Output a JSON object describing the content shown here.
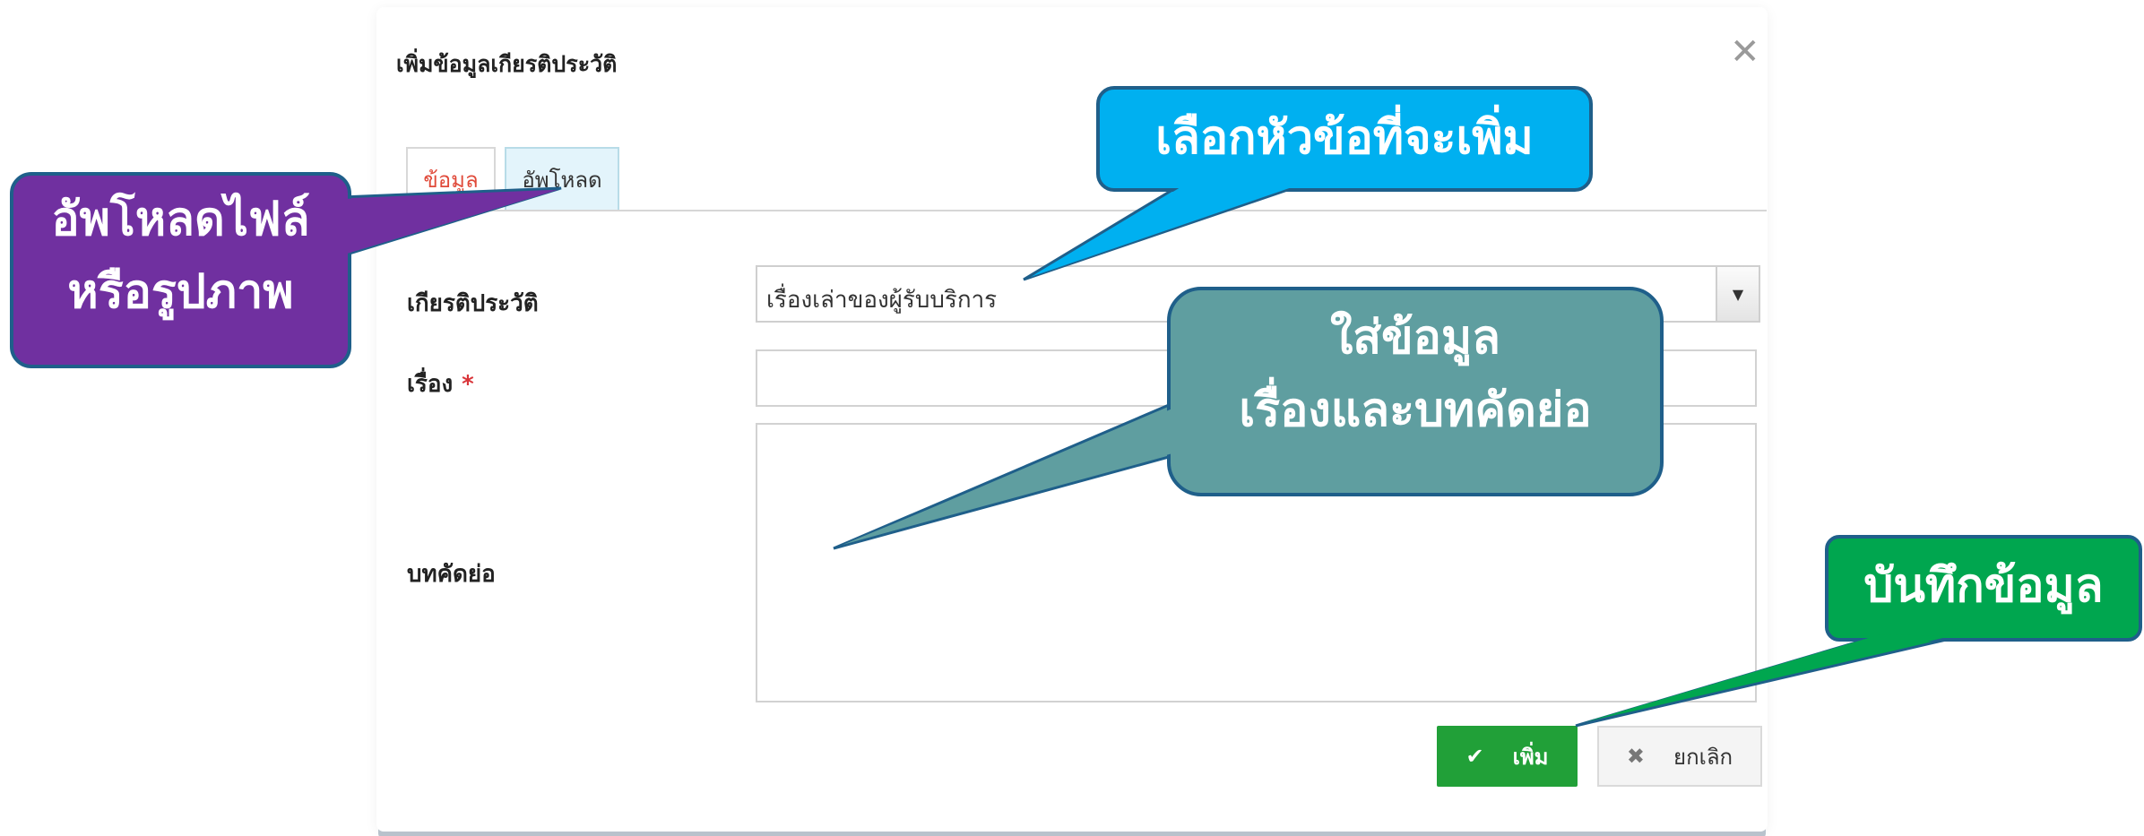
{
  "modal": {
    "title": "เพิ่มข้อมูลเกียรติประวัติ",
    "close_icon": "close-icon",
    "tabs": [
      {
        "label": "ข้อมูล"
      },
      {
        "label": "อัพโหลด"
      }
    ]
  },
  "form": {
    "honor_label": "เกียรติประวัติ",
    "honor_selected": "เรื่องเล่าของผู้รับบริการ",
    "title_label": "เรื่อง",
    "required_mark": "*",
    "title_value": "",
    "abstract_label": "บทคัดย่อ",
    "abstract_value": ""
  },
  "buttons": {
    "add_label": "เพิ่ม",
    "add_icon": "check-icon",
    "cancel_label": "ยกเลิก",
    "cancel_icon": "x-icon"
  },
  "callouts": {
    "upload_line1": "อัพโหลดไฟล์",
    "upload_line2": "หรือรูปภาพ",
    "select_topic": "เลือกหัวข้อที่จะเพิ่ม",
    "fill_line1": "ใส่ข้อมูล",
    "fill_line2": "เรื่องและบทคัดย่อ",
    "save": "บันทึกข้อมูล"
  },
  "colors": {
    "upload_callout": "#7030a0",
    "select_callout": "#00b0f0",
    "fill_callout": "#5f9ea0",
    "save_callout": "#00a64f",
    "add_button": "#21a038",
    "required": "#d9353a",
    "info_tab_text": "#e04a3a"
  }
}
